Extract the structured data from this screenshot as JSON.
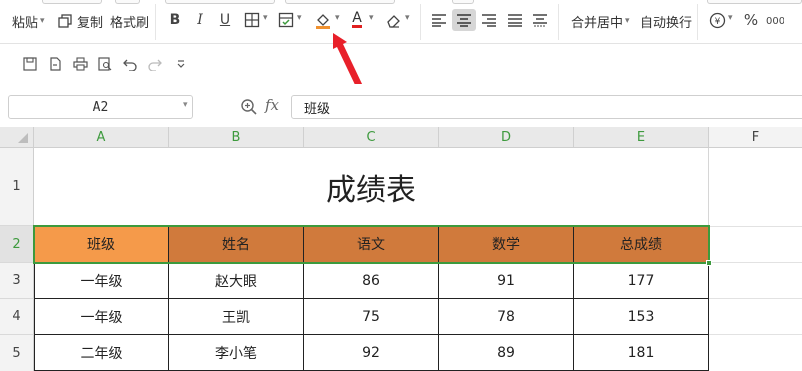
{
  "ribbon": {
    "paste_label": "粘贴",
    "copy_label": "复制",
    "format_painter_label": "格式刷",
    "bold_label": "B",
    "italic_label": "I",
    "underline_label": "U",
    "merge_center_label": "合并居中",
    "wrap_text_label": "自动换行",
    "percent_label": "%",
    "font_color_label": "A",
    "accent_fill_color": "#f0912f",
    "accent_font_color": "#e02020"
  },
  "formula_bar": {
    "name_box": "A2",
    "fx_label": "fx",
    "formula_value": "班级"
  },
  "grid": {
    "columns": [
      "A",
      "B",
      "C",
      "D",
      "E",
      "F"
    ],
    "row_numbers": [
      "1",
      "2",
      "3",
      "4",
      "5"
    ],
    "title": "成绩表",
    "header": [
      "班级",
      "姓名",
      "语文",
      "数学",
      "总成绩"
    ],
    "rows": [
      [
        "一年级",
        "赵大眼",
        "86",
        "91",
        "177"
      ],
      [
        "一年级",
        "王凯",
        "75",
        "78",
        "153"
      ],
      [
        "二年级",
        "李小笔",
        "92",
        "89",
        "181"
      ]
    ],
    "selection_color": "#3d9a3d",
    "header_fill": "#d07a3c",
    "active_fill": "#f59a4a"
  },
  "annotation": {
    "arrow_color": "#e8202a"
  }
}
